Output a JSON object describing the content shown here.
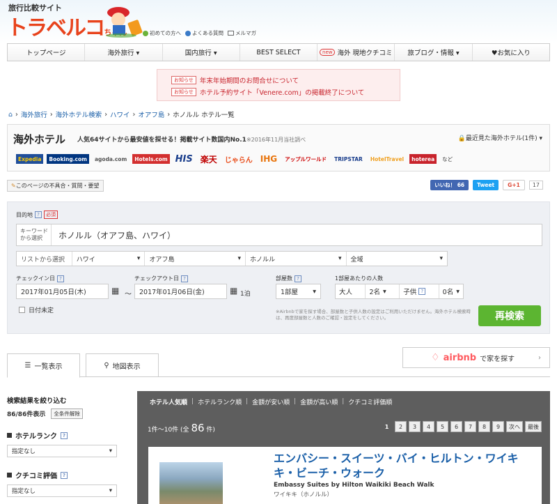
{
  "header": {
    "site_sub": "旅行比較サイト",
    "logo_main": "トラベルコ",
    "logo_tail": "ちゃん",
    "links": [
      "初めての方へ",
      "よくある質問",
      "メルマガ"
    ]
  },
  "nav": {
    "items": [
      "トップページ",
      "海外旅行 ▾",
      "国内旅行 ▾",
      "BEST SELECT",
      "海外 現地クチコミ",
      "旅ブログ・情報 ▾",
      "♥お気に入り"
    ],
    "new_badge": "new"
  },
  "notice": {
    "badge": "お知らせ",
    "items": [
      "年末年始期間のお問合せについて",
      "ホテル予約サイト「Venere.com」の掲載終了について"
    ]
  },
  "breadcrumb": {
    "home": "⌂",
    "items": [
      "海外旅行",
      "海外ホテル検索",
      "ハワイ",
      "オアフ島",
      "ホノルル ホテル一覧"
    ],
    "sep": "›"
  },
  "hotel_header": {
    "title": "海外ホテル",
    "tagline": "人気64サイトから最安値を探せる！掲載サイト数国内No.1",
    "tagline_note": "※2016年11月当社調べ",
    "recent": "最近見た海外ホテル(1件) ▾",
    "partners": [
      "Expedia",
      "Booking.com",
      "agoda.com",
      "Hotels.com",
      "HIS",
      "楽天",
      "じゃらん",
      "IHG",
      "アップルワールド",
      "TRIPSTAR",
      "HotelTravel",
      "hoterea",
      "など"
    ]
  },
  "feedback": {
    "report": "このページの不具合・質問・要望",
    "like": "いいね！ 66",
    "tweet": "Tweet",
    "gplus": "G+1",
    "gplus_count": "17"
  },
  "search": {
    "destination_label": "目的地",
    "required": "必須",
    "keyword_label": "キーワードから選択",
    "keyword_value": "ホノルル（オアフ島、ハワイ）",
    "list_label": "リストから選択",
    "list_values": [
      "ハワイ",
      "オアフ島",
      "ホノルル",
      "全域"
    ],
    "checkin_label": "チェックイン日",
    "checkin_value": "2017年01月05日(木)",
    "checkout_label": "チェックアウト日",
    "checkout_value": "2017年01月06日(金)",
    "nights": "1泊",
    "tilde": "〜",
    "rooms_label": "部屋数",
    "rooms_value": "1部屋",
    "guests_label": "1部屋あたりの人数",
    "adult_label": "大人",
    "adult_value": "2名",
    "child_label": "子供",
    "child_value": "0名",
    "undecided": "日付未定",
    "note": "※Airbnbで家を探す場合、部屋数と子供人数の設定はご利用いただけません。海外ホテル検索時は、再度部屋数と人数のご確認・設定をしてください。",
    "search_button": "再検索"
  },
  "tabs": {
    "list": "一覧表示",
    "map": "地図表示"
  },
  "airbnb": {
    "brand": "airbnb",
    "text": "で家を探す",
    "arrow": "›"
  },
  "sidebar": {
    "title": "検索結果を絞り込む",
    "count": "86/86件表示",
    "clear": "全条件解除",
    "rank_label": "ホテルランク",
    "rank_value": "指定なし",
    "review_label": "クチコミ評価",
    "review_value": "指定なし"
  },
  "results": {
    "sort": [
      "ホテル人気順",
      "ホテルランク順",
      "金額が安い順",
      "金額が高い順",
      "クチコミ評価順"
    ],
    "count_prefix": "1件〜10件 (全",
    "count_total": "86",
    "count_suffix": "件)",
    "pages": [
      "1",
      "2",
      "3",
      "4",
      "5",
      "6",
      "7",
      "8",
      "9",
      "次へ",
      "最後"
    ],
    "hotel_name": "エンバシー・スイーツ・バイ・ヒルトン・ワイキキ・ビーチ・ウォーク",
    "hotel_name_en": "Embassy Suites by Hilton Waikiki Beach Walk",
    "hotel_location": "ワイキキ（ホノルル）"
  }
}
